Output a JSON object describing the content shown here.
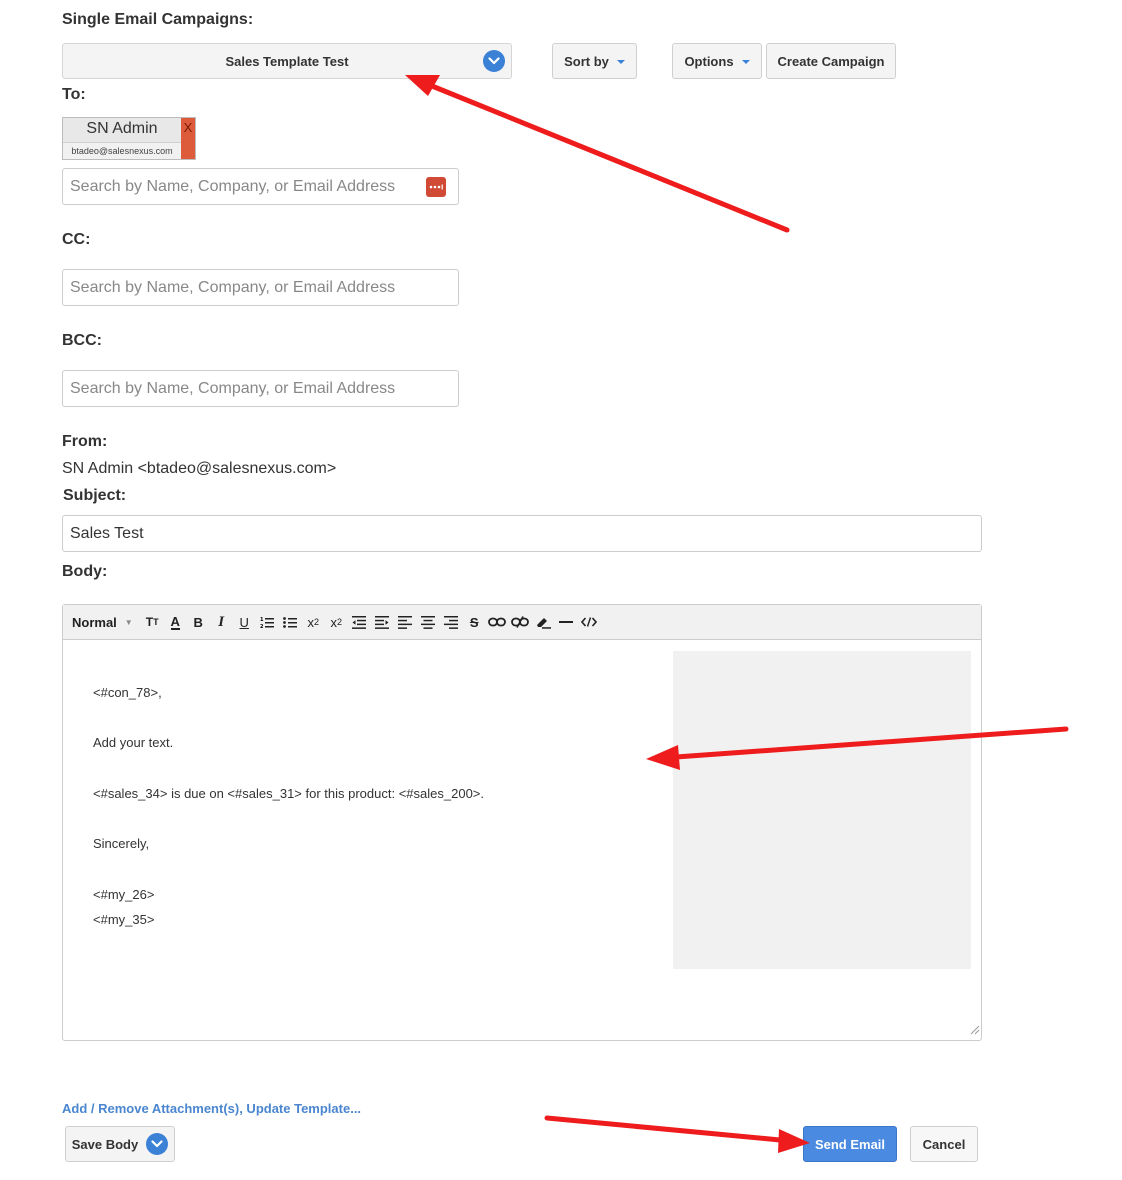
{
  "header": {
    "title": "Single Email Campaigns:"
  },
  "template_select": {
    "value": "Sales Template Test"
  },
  "toolbar": {
    "sort_label": "Sort by",
    "options_label": "Options",
    "create_label": "Create Campaign"
  },
  "to": {
    "label": "To:",
    "recipient": {
      "name": "SN Admin",
      "email": "btadeo@salesnexus.com",
      "remove": "X"
    },
    "placeholder": "Search by Name, Company, or Email Address"
  },
  "cc": {
    "label": "CC:",
    "placeholder": "Search by Name, Company, or Email Address"
  },
  "bcc": {
    "label": "BCC:",
    "placeholder": "Search by Name, Company, or Email Address"
  },
  "from": {
    "label": "From:",
    "value": "SN Admin <btadeo@salesnexus.com>"
  },
  "subject": {
    "label": "Subject:",
    "value": "Sales Test"
  },
  "body": {
    "label": "Body:",
    "format": "Normal",
    "lines": [
      "<#con_78>,",
      "Add your text.",
      "<#sales_34> is due on <#sales_31> for this product: <#sales_200>.",
      "Sincerely,",
      "<#my_26>",
      "<#my_35>"
    ]
  },
  "footer": {
    "link": "Add / Remove Attachment(s), Update Template...",
    "save_body": "Save Body",
    "send": "Send Email",
    "cancel": "Cancel"
  },
  "colors": {
    "accent": "#4a8ae0",
    "remove": "#dd5b3a",
    "annotation_arrow": "#ee1c1c"
  },
  "icons": [
    "chevron-down-icon",
    "password-manager-icon",
    "text-size-icon",
    "font-color-icon",
    "bold-icon",
    "italic-icon",
    "underline-icon",
    "ordered-list-icon",
    "bullet-list-icon",
    "subscript-icon",
    "superscript-icon",
    "indent-icon",
    "outdent-icon",
    "align-left-icon",
    "align-center-icon",
    "align-right-icon",
    "strikethrough-icon",
    "link-icon",
    "unlink-icon",
    "clean-icon",
    "horizontal-rule-icon",
    "code-view-icon",
    "resize-handle-icon",
    "arrow-annotation"
  ]
}
